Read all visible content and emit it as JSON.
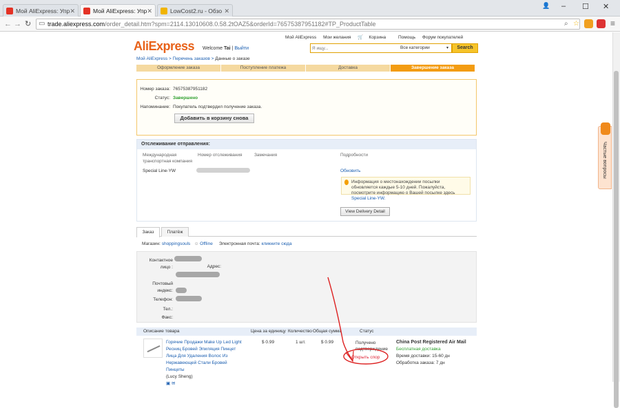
{
  "browser": {
    "tabs": [
      {
        "label": "Мой AliExpress: Упр"
      },
      {
        "label": "Мой AliExpress: Упр"
      },
      {
        "label": "LowCost2.ru - Обзо"
      }
    ],
    "url_host": "trade.aliexpress.com",
    "url_path": "/order_detail.htm?spm=2114.13010608.0.58.2tOAZ5&orderId=76575387951182#TP_ProductTable"
  },
  "header": {
    "logo": "AliExpress",
    "welcome": "Welcome",
    "user": "Tai",
    "logout": "Выйти",
    "nav": [
      "Мой AliExpress",
      "Мои желания",
      "Корзина",
      "Помощь",
      "Форум покупателей"
    ],
    "search_placeholder": "Я ищу...",
    "search_category": "Все категории",
    "search_button": "Search"
  },
  "breadcrumb": {
    "item1": "Мой AliExpress",
    "item2": "Перечень заказов",
    "current": "Данные о заказе"
  },
  "steps": [
    "Оформление заказа",
    "Поступление платежа",
    "Доставка",
    "Завершение заказа"
  ],
  "order": {
    "number_label": "Номер заказа:",
    "number": "76575387951182",
    "status_label": "Статус:",
    "status": "Завершено",
    "reminder_label": "Напоминание:",
    "reminder": "Покупатель подтвердил получение заказа.",
    "add_to_cart": "Добавить в корзину снова"
  },
  "tracking": {
    "title": "Отслеживание отправления:",
    "col_carrier": "Международная транспортная компания",
    "col_number": "Номер отслеживания",
    "col_notes": "Замечания",
    "col_details": "Подробности",
    "carrier": "Special Line-YW",
    "refresh": "Обновить",
    "info": "Информация о местонахождении посылки обновляется каждые 5-10 дней. Пожалуйста, посмотрите информацию о Вашей посылке здесь",
    "info_link": "Special Line-YW.",
    "delivery_button": "View Delivery Detail"
  },
  "subtabs": {
    "order": "Заказ",
    "payment": "Платёж"
  },
  "shop": {
    "label": "Магазин:",
    "name": "shoppingsouls",
    "status": "Offline",
    "email_label": "Электронная почта:",
    "email_link": "кликните сюда"
  },
  "contact": {
    "person": "Контактное лицо :",
    "address": "Адрес:",
    "zip": "Почтовый индекс:",
    "phone": "Телефон:",
    "tel": "Тел.:",
    "fax": "Факс:"
  },
  "products": {
    "col_desc": "Описание товара",
    "col_price": "Цена за единицу",
    "col_qty": "Количество",
    "col_total": "Общая сумма",
    "col_status": "Статус",
    "title": "Горячие Продажи Make Up Led Light Ресниц Бровей Эпиляция Пинцет Лица Для Удаления Волос Из Нержавеющей Стали Бровей Пинцеты",
    "seller": "(Lucy Sheng)",
    "price": "$ 0.99",
    "qty": "1 шт.",
    "total": "$ 0.99",
    "status": "Получено подтверждение",
    "dispute": "Открыть спор",
    "ship_method": "China Post Registered Air Mail",
    "ship_free": "Бесплатная доставка",
    "ship_time": "Время доставки: 15-60 дн",
    "ship_process": "Обработка заказа: 7 дн"
  },
  "help_tab": "Частые вопросы"
}
